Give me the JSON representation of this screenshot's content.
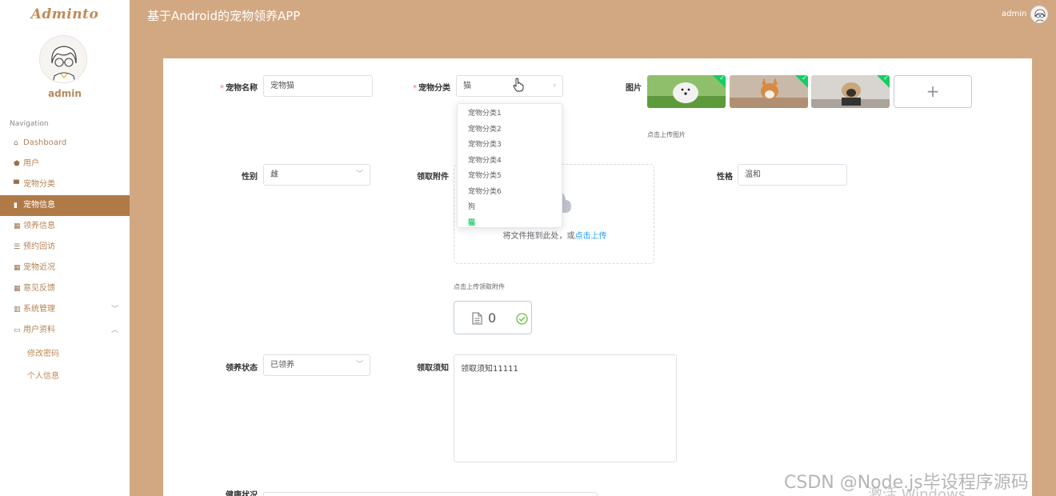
{
  "app": {
    "logo": "Adminto",
    "title": "基于Android的宠物领养APP"
  },
  "user": {
    "name": "admin"
  },
  "header": {
    "username": "admin"
  },
  "nav": {
    "heading": "Navigation",
    "items": [
      {
        "label": "Dashboard",
        "icon": "home-icon"
      },
      {
        "label": "用户",
        "icon": "shield-icon"
      },
      {
        "label": "宠物分类",
        "icon": "monitor-icon"
      },
      {
        "label": "宠物信息",
        "icon": "bar-chart-icon"
      },
      {
        "label": "领养信息",
        "icon": "grid-icon"
      },
      {
        "label": "预约回访",
        "icon": "list-icon"
      },
      {
        "label": "宠物近况",
        "icon": "grid-icon"
      },
      {
        "label": "意见反馈",
        "icon": "grid-icon"
      },
      {
        "label": "系统管理",
        "icon": "library-icon"
      },
      {
        "label": "用户资料",
        "icon": "card-icon"
      }
    ],
    "sub_items": [
      "修改密码",
      "个人信息"
    ]
  },
  "form": {
    "pet_name": {
      "label": "宠物名称",
      "value": "宠物猫"
    },
    "pet_category": {
      "label": "宠物分类",
      "value": "猫"
    },
    "images": {
      "label": "图片",
      "tip": "点击上传图片",
      "add_symbol": "+"
    },
    "gender": {
      "label": "性别",
      "value": "雌"
    },
    "attachment": {
      "label": "领取附件",
      "drop_text": "将文件拖到此处，或",
      "upload_link": "点击上传",
      "tip": "点击上传领取附件",
      "file_count": "0"
    },
    "temperament": {
      "label": "性格",
      "value": "温和"
    },
    "adopt_status": {
      "label": "领养状态",
      "value": "已领养"
    },
    "notice": {
      "label": "领取须知",
      "value": "领取须知11111"
    },
    "health": {
      "label": "健康状况"
    }
  },
  "dropdown": {
    "options": [
      "宠物分类1",
      "宠物分类2",
      "宠物分类3",
      "宠物分类4",
      "宠物分类5",
      "宠物分类6",
      "狗",
      "猫"
    ],
    "selected": "猫"
  },
  "watermark": {
    "line1": "CSDN @Node.js毕设程序源码",
    "line2": "激活 Windows"
  },
  "colors": {
    "accent": "#b07a48",
    "background": "#d2a882",
    "success": "#13ce66"
  }
}
